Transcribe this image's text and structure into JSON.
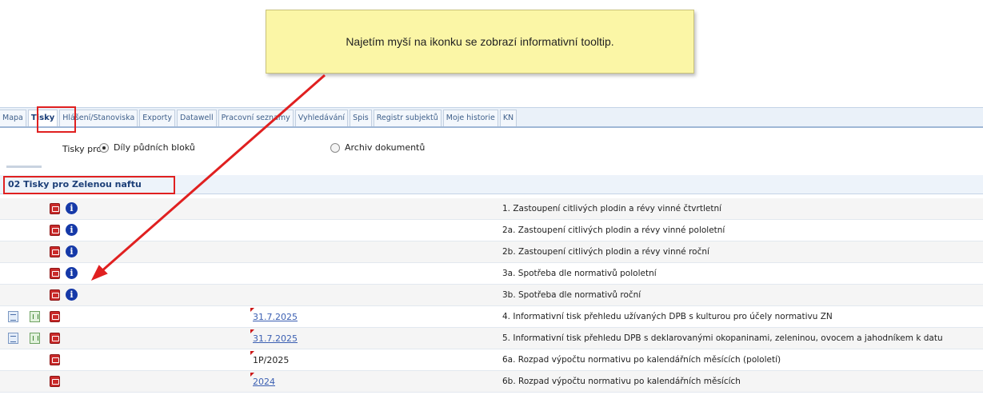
{
  "callout": {
    "text": "Najetím myší na ikonku se zobrazí informativní tooltip."
  },
  "tabs": [
    {
      "label": "Mapa",
      "active": false
    },
    {
      "label": "Tisky",
      "active": true
    },
    {
      "label": "Hlášení/Stanoviska",
      "active": false
    },
    {
      "label": "Exporty",
      "active": false
    },
    {
      "label": "Datawell",
      "active": false
    },
    {
      "label": "Pracovní seznamy",
      "active": false
    },
    {
      "label": "Vyhledávání",
      "active": false
    },
    {
      "label": "Spis",
      "active": false
    },
    {
      "label": "Registr subjektů",
      "active": false
    },
    {
      "label": "Moje historie",
      "active": false
    },
    {
      "label": "KN",
      "active": false
    }
  ],
  "tisky_pro": {
    "label": "Tisky pro:",
    "options": [
      {
        "label": "Díly půdních bloků",
        "checked": true
      },
      {
        "label": "Archiv dokumentů",
        "checked": false
      }
    ]
  },
  "section": {
    "title": "02 Tisky pro Zelenou naftu"
  },
  "rows": [
    {
      "icons": [
        "pdf-icon",
        "info-icon"
      ],
      "date": "",
      "date_link": false,
      "desc": "1. Zastoupení citlivých plodin a révy vinné čtvrtletní"
    },
    {
      "icons": [
        "pdf-icon",
        "info-icon"
      ],
      "date": "",
      "date_link": false,
      "desc": "2a. Zastoupení citlivých plodin a révy vinné pololetní"
    },
    {
      "icons": [
        "pdf-icon",
        "info-icon"
      ],
      "date": "",
      "date_link": false,
      "desc": "2b. Zastoupení citlivých plodin a révy vinné roční"
    },
    {
      "icons": [
        "pdf-icon",
        "info-icon"
      ],
      "date": "",
      "date_link": false,
      "desc": "3a. Spotřeba dle normativů pololetní"
    },
    {
      "icons": [
        "pdf-icon",
        "info-icon"
      ],
      "date": "",
      "date_link": false,
      "desc": "3b. Spotřeba dle normativů roční"
    },
    {
      "icons": [
        "doc-icon",
        "xls-icon",
        "pdf-icon"
      ],
      "date": "31.7.2025",
      "date_link": true,
      "desc": "4. Informativní tisk přehledu užívaných DPB s kulturou pro účely normativu ZN"
    },
    {
      "icons": [
        "doc-icon",
        "xls-icon",
        "pdf-icon"
      ],
      "date": "31.7.2025",
      "date_link": true,
      "desc": "5. Informativní tisk přehledu DPB s deklarovanými okopaninami, zeleninou, ovocem a jahodníkem k datu"
    },
    {
      "icons": [
        "pdf-icon"
      ],
      "date": "1P/2025",
      "date_link": false,
      "desc": "6a. Rozpad výpočtu normativu po kalendářních měsících (pololetí)"
    },
    {
      "icons": [
        "pdf-icon"
      ],
      "date": "2024",
      "date_link": true,
      "desc": "6b. Rozpad výpočtu normativu po kalendářních měsících"
    }
  ],
  "colors": {
    "highlight": "#e02020",
    "callout_bg": "#fbf6a6",
    "info_blue": "#1539a8",
    "pdf_red": "#c92a2a",
    "link": "#3b5fb2"
  }
}
